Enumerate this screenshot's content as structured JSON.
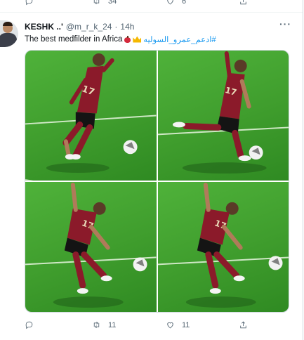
{
  "previous_tweet": {
    "retweets": "34",
    "likes": "6"
  },
  "tweet": {
    "name": "KESHK ..'",
    "handle": "@m_r_k_24",
    "separator": "·",
    "time": "14h",
    "more": "···",
    "text_before": "The best medfilder in Africa",
    "hashtag": "#ادعم_عمرو_السوليه",
    "emoji": [
      "apple-emoji",
      "crown-emoji"
    ],
    "media_count": 4,
    "reply_count": "",
    "retweet_count": "11",
    "like_count": "11"
  },
  "icons": [
    "reply-icon",
    "retweet-icon",
    "like-icon",
    "share-icon",
    "more-icon"
  ],
  "colors": {
    "link": "#1d9bf0",
    "secondary_text": "#536471",
    "kit": "#8b1a2a",
    "pitch": "#3f9d2d"
  }
}
